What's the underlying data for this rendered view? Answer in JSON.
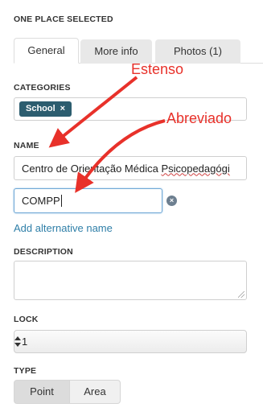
{
  "header": {
    "title": "ONE PLACE SELECTED"
  },
  "tabs": [
    {
      "label": "General",
      "active": true
    },
    {
      "label": "More info",
      "active": false
    },
    {
      "label": "Photos (1)",
      "active": false
    }
  ],
  "categories": {
    "label": "CATEGORIES",
    "chips": [
      {
        "label": "School",
        "remove": "×"
      }
    ]
  },
  "name": {
    "label": "NAME",
    "value": "Centro de Orientação Médica Psicopedagógi",
    "value_prefix": "Centro de Orientação Médica ",
    "value_misspelled": "Psicopedagógi",
    "alternative_value": "COMPP",
    "remove_icon": "×",
    "add_alternative": "Add alternative name"
  },
  "description": {
    "label": "DESCRIPTION",
    "value": ""
  },
  "lock": {
    "label": "LOCK",
    "selected": "1"
  },
  "type": {
    "label": "TYPE",
    "options": [
      "Point",
      "Area"
    ],
    "selected": "Point"
  },
  "annotations": {
    "top": "Estenso",
    "bottom": "Abreviado"
  },
  "colors": {
    "accent": "#2c5d6f",
    "link": "#2f7fa8",
    "annotation": "#e8312a"
  }
}
